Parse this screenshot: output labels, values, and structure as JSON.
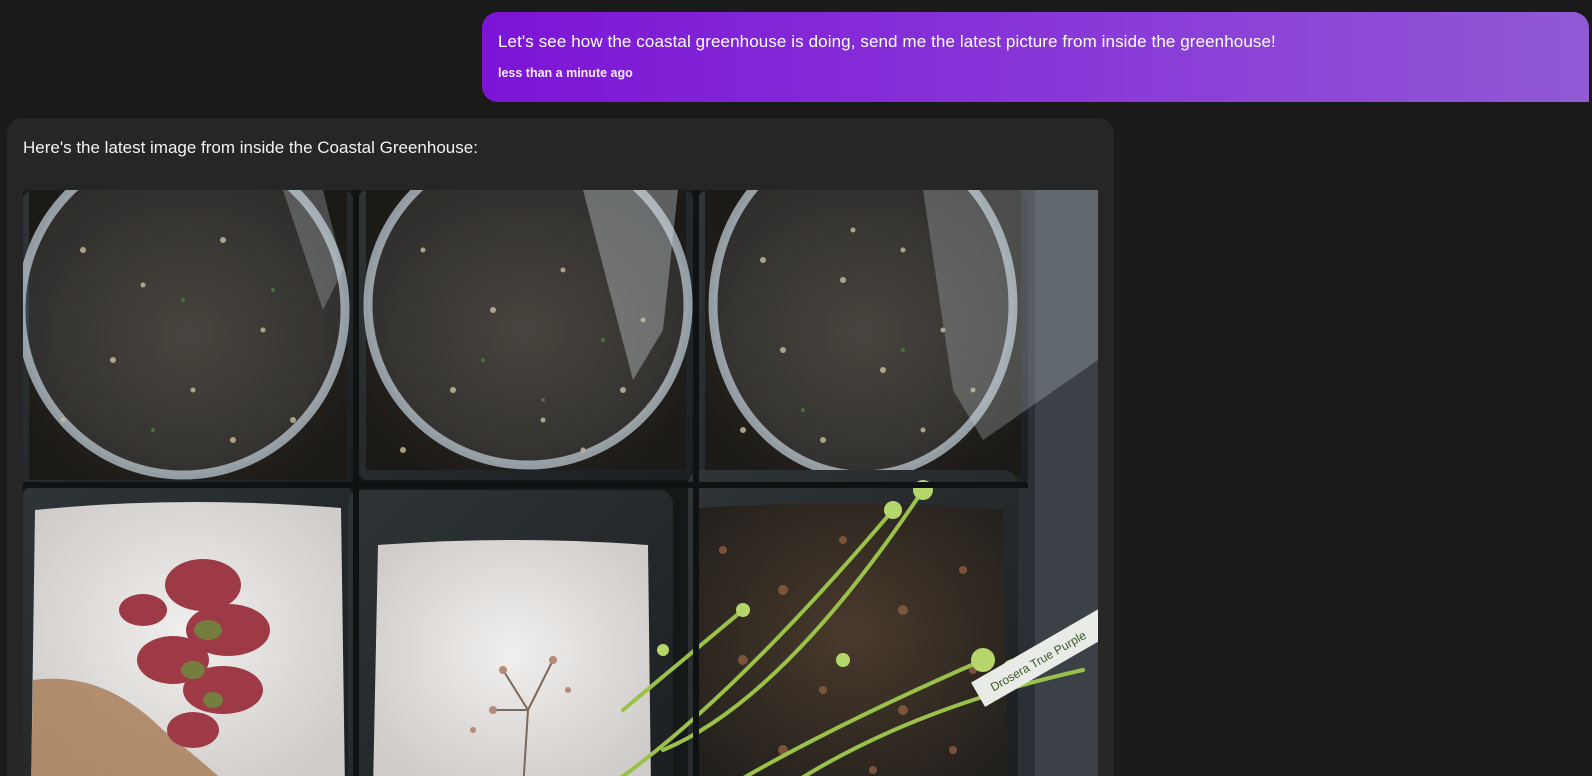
{
  "conversation": {
    "user_message": {
      "text": "Let's see how the coastal greenhouse is doing, send me the latest picture from inside the greenhouse!",
      "timestamp": "less than a minute ago"
    },
    "assistant_message": {
      "text": "Here's the latest image from inside the Coastal Greenhouse:",
      "image": {
        "label_text": "Drosera True Purple"
      }
    }
  },
  "colors": {
    "page_background": "#1a1a1a",
    "user_bubble_start": "#7c14d6",
    "user_bubble_end": "#9159d4",
    "assistant_bubble": "#262626"
  }
}
